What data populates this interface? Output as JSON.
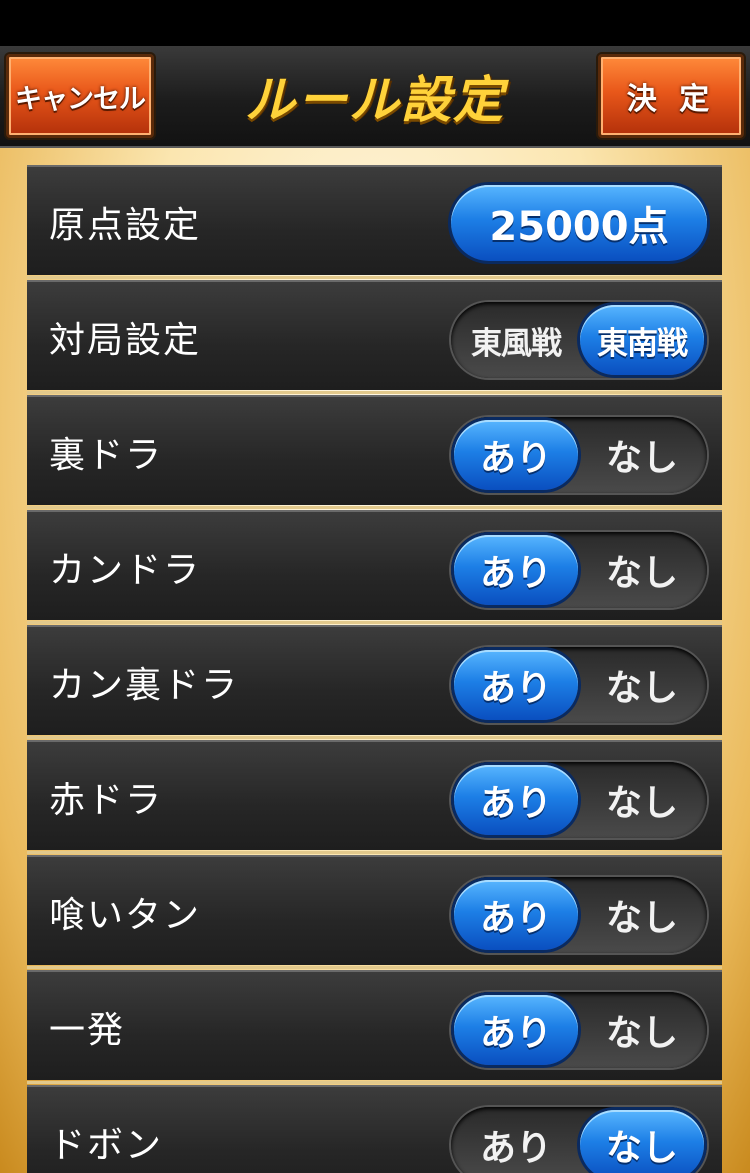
{
  "header": {
    "cancel_label": "キャンセル",
    "title": "ルール設定",
    "confirm_label": "決 定"
  },
  "rules": [
    {
      "label": "原点設定",
      "value": "25000点"
    },
    {
      "label": "対局設定",
      "options": [
        "東風戦",
        "東南戦"
      ],
      "selected": 1
    },
    {
      "label": "裏ドラ",
      "options": [
        "あり",
        "なし"
      ],
      "selected": 0
    },
    {
      "label": "カンドラ",
      "options": [
        "あり",
        "なし"
      ],
      "selected": 0
    },
    {
      "label": "カン裏ドラ",
      "options": [
        "あり",
        "なし"
      ],
      "selected": 0
    },
    {
      "label": "赤ドラ",
      "options": [
        "あり",
        "なし"
      ],
      "selected": 0
    },
    {
      "label": "喰いタン",
      "options": [
        "あり",
        "なし"
      ],
      "selected": 0
    },
    {
      "label": "一発",
      "options": [
        "あり",
        "なし"
      ],
      "selected": 0
    },
    {
      "label": "ドボン",
      "options": [
        "あり",
        "なし"
      ],
      "selected": 1
    }
  ],
  "colors": {
    "accent_blue": "#1d7fe6",
    "button_orange": "#e8571a",
    "title_gold": "#ffd23a"
  }
}
